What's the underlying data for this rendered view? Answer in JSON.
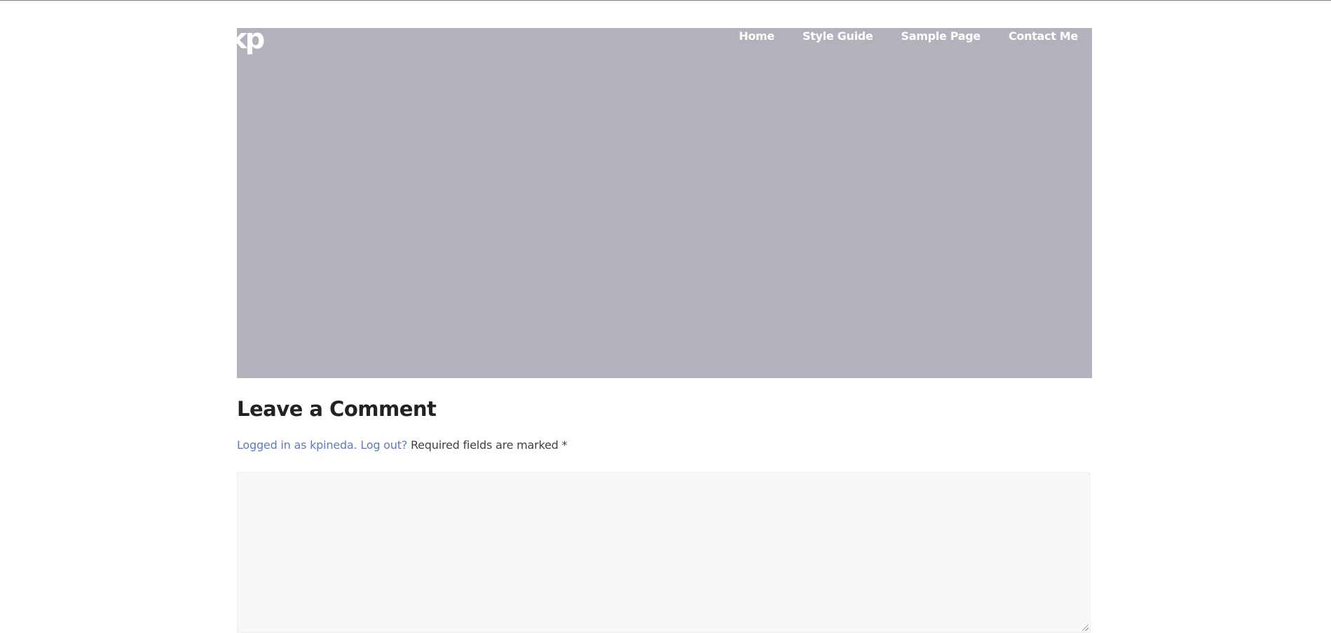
{
  "site": {
    "logo_text": "kp"
  },
  "nav": {
    "items": [
      {
        "label": "Home"
      },
      {
        "label": "Style Guide"
      },
      {
        "label": "Sample Page"
      },
      {
        "label": "Contact Me"
      }
    ]
  },
  "hero": {
    "background_color": "#b2b2bd"
  },
  "comments": {
    "title": "Leave a Comment",
    "logged_in_text": "Logged in as kpineda.",
    "logout_text": "Log out?",
    "required_text": "Required fields are marked",
    "required_marker": "*",
    "comment_value": "",
    "link_color": "#5a7bc4"
  }
}
